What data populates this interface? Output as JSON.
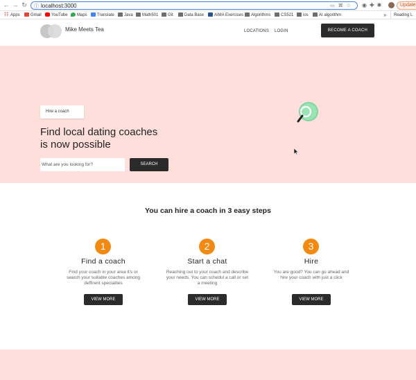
{
  "browser": {
    "url": "localhost:3000",
    "update_label": "Update",
    "bookmarks": [
      "Apps",
      "Gmail",
      "YouTube",
      "Maps",
      "Translate",
      "Java",
      "Math501",
      "Git",
      "Data Base",
      "AIMA Exercises",
      "Algorithms",
      "CS521",
      "ios",
      "AI algorithm"
    ],
    "reading_list": "Reading L",
    "more": "»"
  },
  "header": {
    "brand": "Mike Meets Tea",
    "nav": [
      "LOCATIONS",
      "LOGIN"
    ],
    "cta": "BECOME A COACH"
  },
  "hero": {
    "chip": "Hire a coach",
    "title_line1": "Find local dating coaches",
    "title_line2": "is now possible",
    "search_placeholder": "What are you looking for?",
    "search_button": "SEARCH"
  },
  "steps": {
    "title": "You can hire a coach in 3 easy steps",
    "items": [
      {
        "num": "1",
        "title": "Find a coach",
        "desc": "Find your coach in your area it's or search your suitable coaches among deffirent specialties",
        "button": "VIEW MORE"
      },
      {
        "num": "2",
        "title": "Start a chat",
        "desc": "Reaching out to your coach and describe your needs. You can schedul a call or set a meeting",
        "button": "VIEW MORE"
      },
      {
        "num": "3",
        "title": "Hire",
        "desc": "You are good? You can go ahead and hire your coach with just a click",
        "button": "VIEW MORE"
      }
    ]
  },
  "colors": {
    "hero_bg": "#ffdfdc",
    "dark_button": "#2b2b2b",
    "step_accent": "#f28a11"
  }
}
